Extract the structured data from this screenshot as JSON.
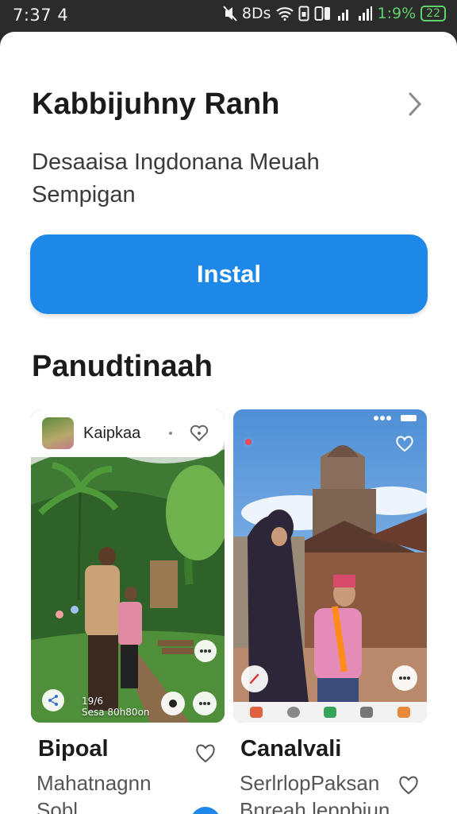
{
  "status_bar": {
    "time": "7:37 4",
    "icons": "8Ds",
    "battery_percent": "1:9%",
    "battery_badge": "22"
  },
  "app": {
    "title": "Kabbijuhny Ranh",
    "description": "Desaaisa Ingdonana Meuah Sempigan",
    "install_label": "Instal"
  },
  "section": {
    "title": "Panudtinaah"
  },
  "cards": [
    {
      "header_name": "Kaipkaa",
      "caption_line1": "19/6",
      "caption_line2": "Sesa 80h80on",
      "title": "Bipoal",
      "subtitle": "Mahatnagnn",
      "subtitle2": "Sobl"
    },
    {
      "title": "Canalvali",
      "subtitle": "SerlrlopPaksan",
      "subtitle2": "Bnreah.leppbiun"
    }
  ],
  "colors": {
    "accent": "#1e88e8",
    "status_bar_bg": "#2b2b2b",
    "battery": "#5ed36b",
    "text_primary": "#1b1b1b"
  },
  "icons": [
    "chevron-right-icon",
    "heart-icon",
    "wifi-icon",
    "signal-icon",
    "battery-icon",
    "more-icon",
    "play-icon",
    "share-icon"
  ]
}
